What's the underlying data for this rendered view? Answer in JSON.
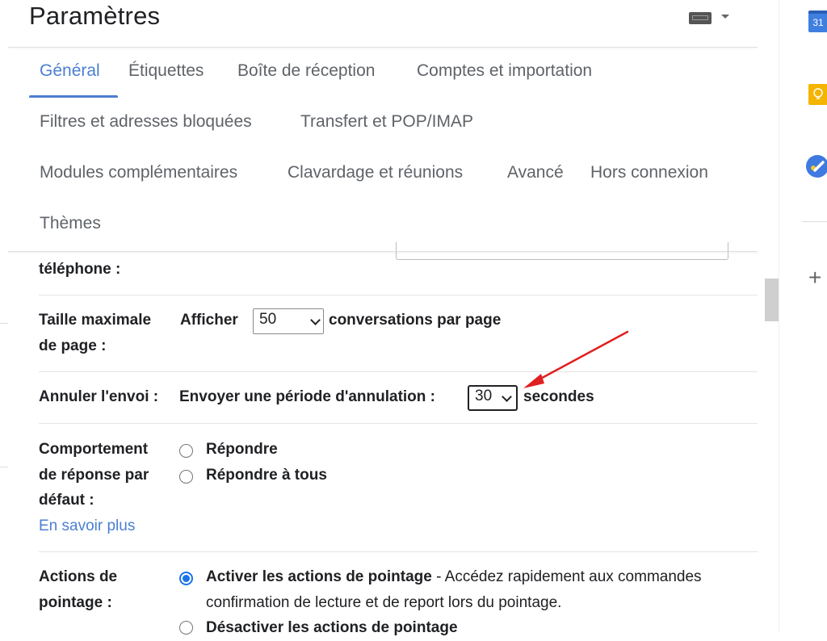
{
  "header": {
    "title": "Paramètres",
    "keyboard_icon": "keyboard-icon",
    "dropdown_icon": "caret-down-icon"
  },
  "tabs": [
    {
      "label": "Général",
      "active": true
    },
    {
      "label": "Étiquettes"
    },
    {
      "label": "Boîte de réception"
    },
    {
      "label": "Comptes et importation"
    },
    {
      "label": "Filtres et adresses bloquées"
    },
    {
      "label": "Transfert et POP/IMAP"
    },
    {
      "label": "Modules complémentaires"
    },
    {
      "label": "Clavardage et réunions"
    },
    {
      "label": "Avancé"
    },
    {
      "label": "Hors connexion"
    },
    {
      "label": "Thèmes"
    }
  ],
  "settings": {
    "phone": {
      "label": "téléphone :"
    },
    "page_size": {
      "label_line1": "Taille maximale",
      "label_line2": "de page :",
      "prefix": "Afficher",
      "value": "50",
      "suffix": "conversations par page"
    },
    "undo_send": {
      "label": "Annuler l'envoi :",
      "prefix": "Envoyer une période d'annulation :",
      "value": "30",
      "suffix": "secondes"
    },
    "reply_behavior": {
      "label_line1": "Comportement",
      "label_line2": "de réponse par",
      "label_line3": "défaut :",
      "link": "En savoir plus",
      "options": [
        {
          "label": "Répondre",
          "checked": false
        },
        {
          "label": "Répondre à tous",
          "checked": false
        }
      ]
    },
    "hover_actions": {
      "label_line1": "Actions de",
      "label_line2": "pointage :",
      "options": [
        {
          "label": "Activer les actions de pointage",
          "description": " - Accédez rapidement aux commandes",
          "description_line2": "confirmation de lecture et de report lors du pointage.",
          "checked": true
        },
        {
          "label": "Désactiver les actions de pointage",
          "checked": false
        }
      ]
    }
  },
  "annotation": {
    "arrow_color": "#e02020",
    "target": "undo-send-select"
  },
  "side_panel": {
    "calendar_label": "31",
    "icons": [
      "calendar-icon",
      "keep-icon",
      "tasks-icon",
      "add-icon"
    ]
  }
}
